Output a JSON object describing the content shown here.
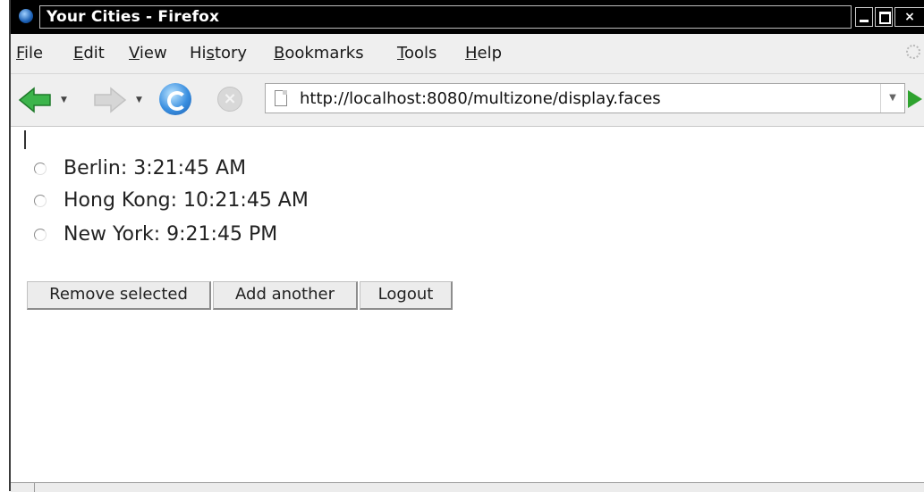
{
  "window": {
    "title": "Your Cities - Firefox"
  },
  "menu": {
    "file": {
      "first": "F",
      "rest": "ile"
    },
    "edit": {
      "first": "E",
      "rest": "dit"
    },
    "view": {
      "first": "V",
      "rest": "iew"
    },
    "history": {
      "before": "Hi",
      "u": "s",
      "after": "tory"
    },
    "bookmarks": {
      "first": "B",
      "rest": "ookmarks"
    },
    "tools": {
      "first": "T",
      "rest": "ools"
    },
    "help": {
      "first": "H",
      "rest": "elp"
    }
  },
  "toolbar": {
    "url": "http://localhost:8080/multizone/display.faces",
    "icons": [
      "back-arrow-icon",
      "forward-arrow-icon",
      "reload-icon",
      "stop-icon",
      "page-icon",
      "go-icon"
    ]
  },
  "cities": [
    {
      "label": "Berlin: 3:21:45 AM"
    },
    {
      "label": "Hong Kong: 10:21:45 AM"
    },
    {
      "label": "New York: 9:21:45 PM"
    }
  ],
  "buttons": {
    "remove": "Remove selected",
    "add": "Add another",
    "logout": "Logout"
  },
  "colors": {
    "titlebar": "#000000",
    "chrome": "#efefef",
    "go_green": "#2fa32f",
    "back_green": "#3cb44b"
  }
}
